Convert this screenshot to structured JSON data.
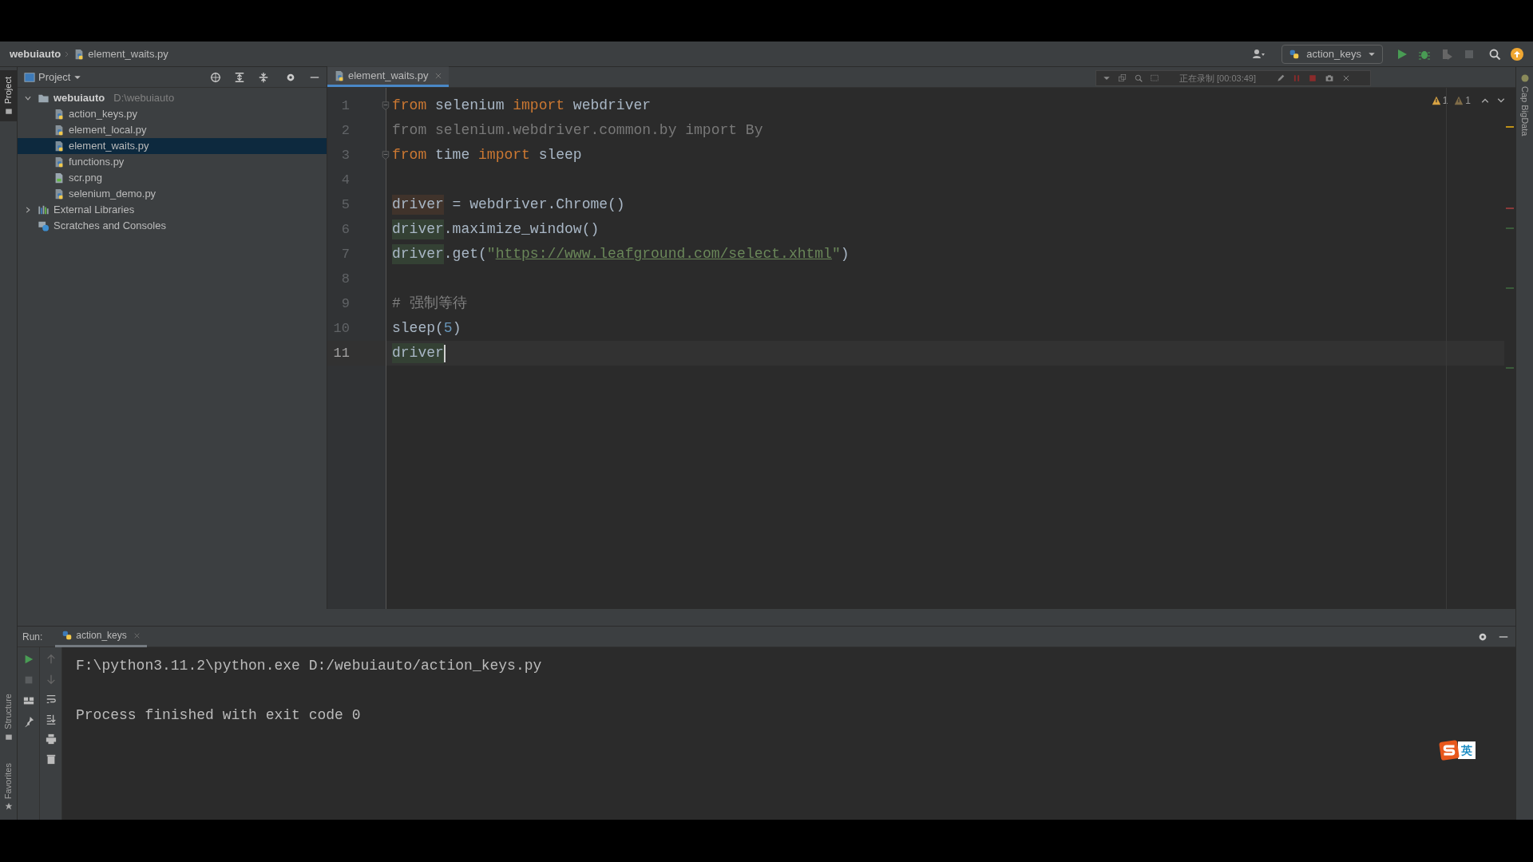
{
  "breadcrumbs": [
    "webuiauto",
    "element_waits.py"
  ],
  "run_config": {
    "label": "action_keys"
  },
  "left_stripe": [
    {
      "label": "Project",
      "selected": true
    },
    {
      "label": "Structure",
      "selected": false
    },
    {
      "label": "Favorites",
      "selected": false
    }
  ],
  "right_stripe": [
    {
      "label": "Cap BigData"
    }
  ],
  "project": {
    "title": "Project",
    "tree": [
      {
        "label": "webuiauto",
        "path": "D:\\webuiauto",
        "kind": "folder",
        "expanded": true,
        "selected": false,
        "children": [
          {
            "label": "action_keys.py",
            "kind": "python",
            "selected": false
          },
          {
            "label": "element_local.py",
            "kind": "python",
            "selected": false
          },
          {
            "label": "element_waits.py",
            "kind": "python",
            "selected": true
          },
          {
            "label": "functions.py",
            "kind": "python",
            "selected": false
          },
          {
            "label": "scr.png",
            "kind": "image",
            "selected": false
          },
          {
            "label": "selenium_demo.py",
            "kind": "python",
            "selected": false
          }
        ]
      },
      {
        "label": "External Libraries",
        "kind": "library",
        "expanded": false,
        "selected": false
      },
      {
        "label": "Scratches and Consoles",
        "kind": "scratch",
        "selected": false
      }
    ]
  },
  "editor": {
    "tabs": [
      {
        "label": "element_waits.py",
        "selected": true
      }
    ],
    "recording": {
      "status": "正在录制 [00:03:49]"
    },
    "inspections": [
      {
        "kind": "warning",
        "count": "1"
      },
      {
        "kind": "weak_warning",
        "count": "1"
      }
    ],
    "lines": [
      {
        "number": "1",
        "fold": true,
        "current": false,
        "tokens": [
          {
            "kind": "keyword",
            "text": "from"
          },
          {
            "kind": "plain",
            "text": " selenium "
          },
          {
            "kind": "keyword",
            "text": "import"
          },
          {
            "kind": "plain",
            "text": " webdriver"
          }
        ]
      },
      {
        "number": "2",
        "fold": false,
        "current": false,
        "tokens": [
          {
            "kind": "unused",
            "text": "from selenium.webdriver.common.by import By"
          }
        ]
      },
      {
        "number": "3",
        "fold": true,
        "current": false,
        "tokens": [
          {
            "kind": "keyword",
            "text": "from"
          },
          {
            "kind": "plain",
            "text": " time "
          },
          {
            "kind": "keyword",
            "text": "import"
          },
          {
            "kind": "plain",
            "text": " sleep"
          }
        ]
      },
      {
        "number": "4",
        "fold": false,
        "current": false
      },
      {
        "number": "5",
        "fold": false,
        "current": false,
        "tokens": [
          {
            "kind": "write_usage",
            "text": "driver"
          },
          {
            "kind": "plain",
            "text": " = webdriver.Chrome()"
          }
        ]
      },
      {
        "number": "6",
        "fold": false,
        "current": false,
        "tokens": [
          {
            "kind": "read_usage",
            "text": "driver"
          },
          {
            "kind": "plain",
            "text": ".maximize_window()"
          }
        ]
      },
      {
        "number": "7",
        "fold": false,
        "current": false,
        "tokens": [
          {
            "kind": "read_usage",
            "text": "driver"
          },
          {
            "kind": "plain",
            "text": ".get("
          },
          {
            "kind": "string",
            "text": "\""
          },
          {
            "kind": "link",
            "text": "https://www.leafground.com/select.xhtml"
          },
          {
            "kind": "string",
            "text": "\""
          },
          {
            "kind": "plain",
            "text": ")"
          }
        ]
      },
      {
        "number": "8",
        "fold": false,
        "current": false
      },
      {
        "number": "9",
        "fold": false,
        "current": false,
        "tokens": [
          {
            "kind": "comment",
            "text": "# 强制等待"
          }
        ]
      },
      {
        "number": "10",
        "fold": false,
        "current": false,
        "tokens": [
          {
            "kind": "plain",
            "text": "sleep("
          },
          {
            "kind": "number",
            "text": "5"
          },
          {
            "kind": "plain",
            "text": ")"
          }
        ]
      },
      {
        "number": "11",
        "fold": false,
        "current": true,
        "tokens": [
          {
            "kind": "read_usage",
            "text": "driver"
          }
        ]
      }
    ]
  },
  "run": {
    "label": "Run:",
    "tabs": [
      {
        "label": "action_keys",
        "selected": true
      }
    ],
    "output": [
      "F:\\python3.11.2\\python.exe D:/webuiauto/action_keys.py",
      "Process finished with exit code 0"
    ]
  },
  "ime": {
    "label": "英"
  }
}
